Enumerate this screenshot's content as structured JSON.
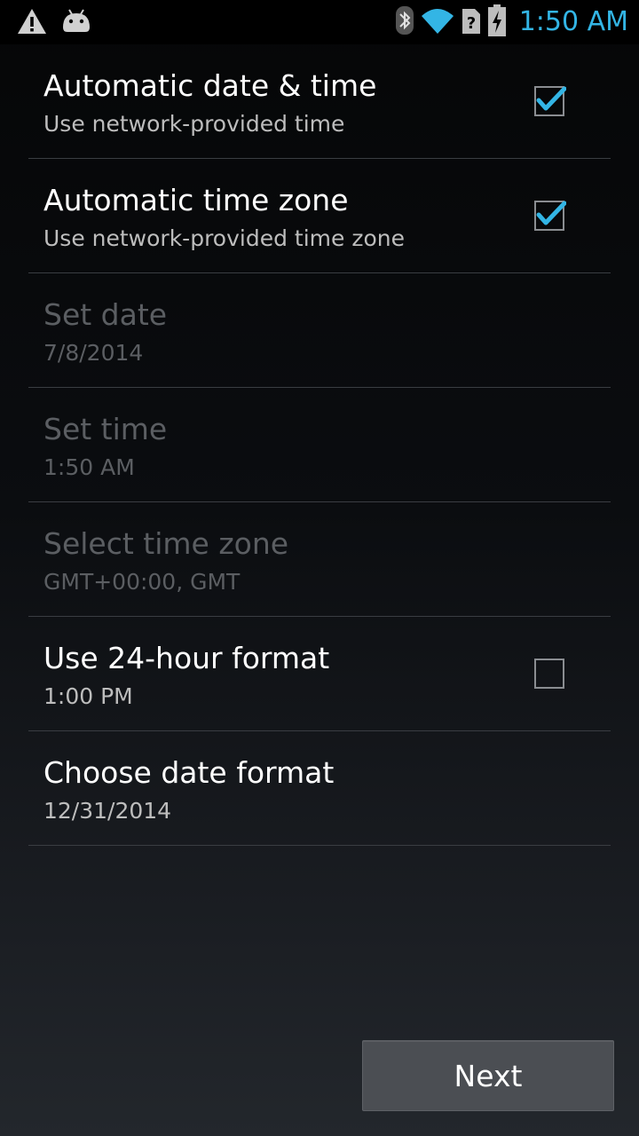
{
  "status_bar": {
    "left_icons": [
      "warning-icon",
      "android-debug-icon"
    ],
    "right_icons": [
      "bluetooth-icon",
      "wifi-icon",
      "no-sim-icon",
      "battery-charging-icon"
    ],
    "time": "1:50 AM",
    "time_color": "#33b5e5"
  },
  "settings": {
    "items": [
      {
        "title": "Automatic date & time",
        "summary": "Use network-provided time",
        "checkbox": true,
        "checked": true,
        "enabled": true
      },
      {
        "title": "Automatic time zone",
        "summary": "Use network-provided time zone",
        "checkbox": true,
        "checked": true,
        "enabled": true
      },
      {
        "title": "Set date",
        "summary": "7/8/2014",
        "checkbox": false,
        "enabled": false
      },
      {
        "title": "Set time",
        "summary": "1:50 AM",
        "checkbox": false,
        "enabled": false
      },
      {
        "title": "Select time zone",
        "summary": "GMT+00:00, GMT",
        "checkbox": false,
        "enabled": false
      },
      {
        "title": "Use 24-hour format",
        "summary": "1:00 PM",
        "checkbox": true,
        "checked": false,
        "enabled": true
      },
      {
        "title": "Choose date format",
        "summary": "12/31/2014",
        "checkbox": false,
        "enabled": true
      }
    ]
  },
  "footer": {
    "next_label": "Next"
  },
  "colors": {
    "accent": "#33b5e5",
    "disabled_text": "#5b5e62",
    "divider": "#3a3d42"
  }
}
